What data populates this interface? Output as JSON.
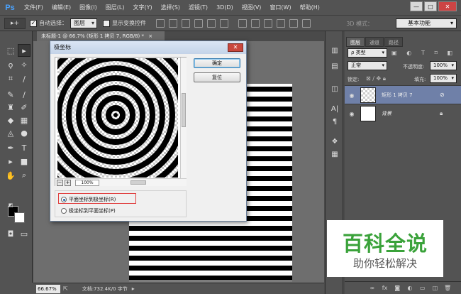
{
  "app": {
    "logo": "Ps"
  },
  "menu": [
    "文件(F)",
    "编辑(E)",
    "图像(I)",
    "图层(L)",
    "文字(Y)",
    "选择(S)",
    "滤镜(T)",
    "3D(D)",
    "视图(V)",
    "窗口(W)",
    "帮助(H)"
  ],
  "window_controls": {
    "minimize": "—",
    "maximize": "□",
    "close": "✕"
  },
  "options": {
    "tool_glyph": "▸+",
    "auto_select_check": "✓",
    "auto_select_label": "自动选择：",
    "auto_select_value": "图层",
    "show_transform_label": "显示变换控件",
    "mode_3d": "3D 模式：",
    "workspace": "基本功能"
  },
  "document": {
    "tab": "未标题-1 @ 66.7% (矩形 1 拷贝 7, RGB/8) *",
    "tab_close": "×"
  },
  "status": {
    "zoom": "66.67%",
    "info": "文档:732.4K/0 字节"
  },
  "dialog": {
    "title": "极坐标",
    "close_glyph": "✕",
    "ok": "确定",
    "reset": "复位",
    "preview_zoom": "100%",
    "zoom_minus": "−",
    "zoom_plus": "+",
    "options": [
      {
        "label": "平面坐标到极坐标(R)",
        "selected": true
      },
      {
        "label": "极坐标到平面坐标(P)",
        "selected": false
      }
    ]
  },
  "layers": {
    "tabs": [
      "图层",
      "通道",
      "路径"
    ],
    "filter_label": "ρ 类型",
    "blend_mode": "正常",
    "opacity_label": "不透明度:",
    "opacity_value": "100%",
    "lock_label": "锁定:",
    "fill_label": "填充:",
    "fill_value": "100%",
    "items": [
      {
        "name": "矩形 1 拷贝 7",
        "selected": true
      },
      {
        "name": "背景",
        "selected": false
      }
    ]
  },
  "watermark": {
    "title": "百科全说",
    "subtitle": "助你轻松解决"
  },
  "colors": {
    "accent": "#4aa3ff",
    "selected_layer": "#6f80a8",
    "watermark_green": "#3aa23a"
  }
}
